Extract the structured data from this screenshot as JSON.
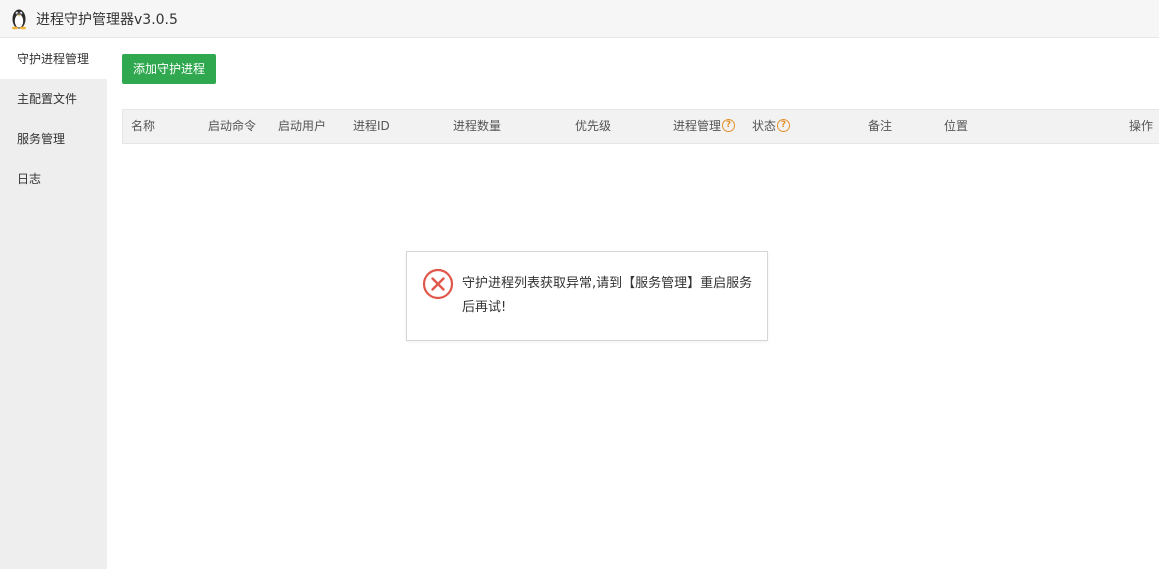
{
  "titlebar": {
    "logo_icon": "linux-penguin-icon",
    "title": "进程守护管理器v3.0.5"
  },
  "sidebar": {
    "items": [
      {
        "label": "守护进程管理",
        "active": true
      },
      {
        "label": "主配置文件",
        "active": false
      },
      {
        "label": "服务管理",
        "active": false
      },
      {
        "label": "日志",
        "active": false
      }
    ]
  },
  "toolbar": {
    "add_label": "添加守护进程",
    "add_color": "#2fa84f"
  },
  "table": {
    "columns": {
      "name": "名称",
      "start_cmd": "启动命令",
      "start_user": "启动用户",
      "pid": "进程ID",
      "proc_count": "进程数量",
      "priority": "优先级",
      "proc_manage": "进程管理",
      "status": "状态",
      "remark": "备注",
      "location": "位置",
      "action": "操作"
    },
    "help_icon": "question-circle-icon",
    "rows": []
  },
  "error_dialog": {
    "icon": "error-x-circle-icon",
    "icon_color": "#e0584b",
    "message": "守护进程列表获取异常,请到【服务管理】重启服务后再试!"
  }
}
